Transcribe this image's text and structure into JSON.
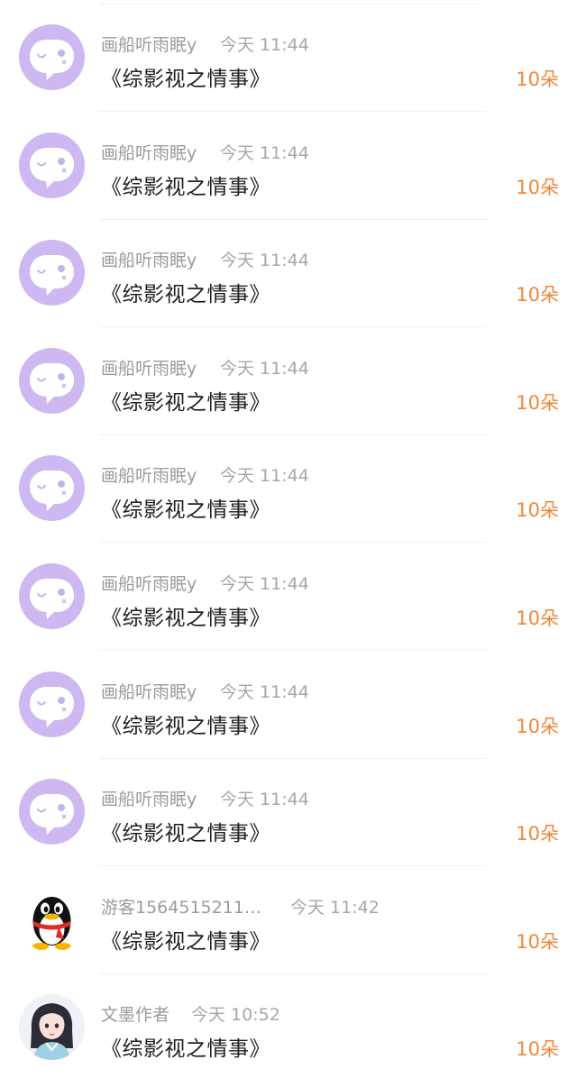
{
  "gifts": [
    {
      "avatar": "purple-chat-bubble-avatar",
      "name": "画船听雨眠y",
      "time": "今天 11:44",
      "title": "《综影视之情事》",
      "amount": "10朵"
    },
    {
      "avatar": "purple-chat-bubble-avatar",
      "name": "画船听雨眠y",
      "time": "今天 11:44",
      "title": "《综影视之情事》",
      "amount": "10朵"
    },
    {
      "avatar": "purple-chat-bubble-avatar",
      "name": "画船听雨眠y",
      "time": "今天 11:44",
      "title": "《综影视之情事》",
      "amount": "10朵"
    },
    {
      "avatar": "purple-chat-bubble-avatar",
      "name": "画船听雨眠y",
      "time": "今天 11:44",
      "title": "《综影视之情事》",
      "amount": "10朵"
    },
    {
      "avatar": "purple-chat-bubble-avatar",
      "name": "画船听雨眠y",
      "time": "今天 11:44",
      "title": "《综影视之情事》",
      "amount": "10朵"
    },
    {
      "avatar": "purple-chat-bubble-avatar",
      "name": "画船听雨眠y",
      "time": "今天 11:44",
      "title": "《综影视之情事》",
      "amount": "10朵"
    },
    {
      "avatar": "purple-chat-bubble-avatar",
      "name": "画船听雨眠y",
      "time": "今天 11:44",
      "title": "《综影视之情事》",
      "amount": "10朵"
    },
    {
      "avatar": "purple-chat-bubble-avatar",
      "name": "画船听雨眠y",
      "time": "今天 11:44",
      "title": "《综影视之情事》",
      "amount": "10朵"
    },
    {
      "avatar": "penguin-avatar",
      "name": "游客1564515211…",
      "time": "今天 11:42",
      "title": "《综影视之情事》",
      "amount": "10朵"
    },
    {
      "avatar": "girl-avatar",
      "name": "文墨作者",
      "time": "今天 10:52",
      "title": "《综影视之情事》",
      "amount": "10朵"
    }
  ],
  "colors": {
    "amount": "#f0873a",
    "avatar_purple": "#cdb8f2",
    "meta_gray": "#9b9b9b"
  }
}
